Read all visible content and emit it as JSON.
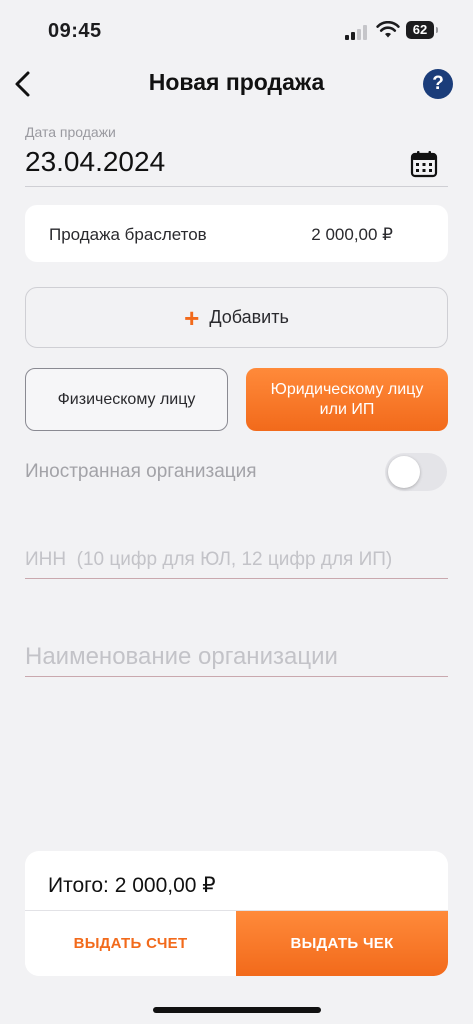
{
  "status_bar": {
    "time": "09:45",
    "battery": "62"
  },
  "nav": {
    "title": "Новая продажа",
    "help": "?"
  },
  "date_field": {
    "label": "Дата продажи",
    "value": "23.04.2024"
  },
  "item": {
    "name": "Продажа браслетов",
    "price": "2 000,00 ₽"
  },
  "add_button": {
    "plus": "+",
    "label": "Добавить"
  },
  "buyer_type": {
    "physical_label": "Физическому лицу",
    "legal_label": "Юридическому лицу или ИП",
    "selected": "legal"
  },
  "foreign_org": {
    "label": "Иностранная организация",
    "enabled": false
  },
  "inn_input": {
    "value": "",
    "placeholder": "ИНН  (10 цифр для ЮЛ, 12 цифр для ИП)"
  },
  "org_input": {
    "value": "",
    "placeholder": "Наименование организации"
  },
  "footer": {
    "total_label": "Итого: 2 000,00 ₽",
    "invoice_label": "ВЫДАТЬ СЧЕТ",
    "receipt_label": "ВЫДАТЬ ЧЕК"
  },
  "colors": {
    "accent": "#f26a1b",
    "help_blue": "#1b3d7a",
    "background": "#f2f2f4"
  },
  "icons": {
    "back": "chevron-left-icon",
    "help": "question-icon",
    "calendar": "calendar-icon",
    "signal": "cellular-signal-icon",
    "wifi": "wifi-icon",
    "battery": "battery-icon"
  }
}
